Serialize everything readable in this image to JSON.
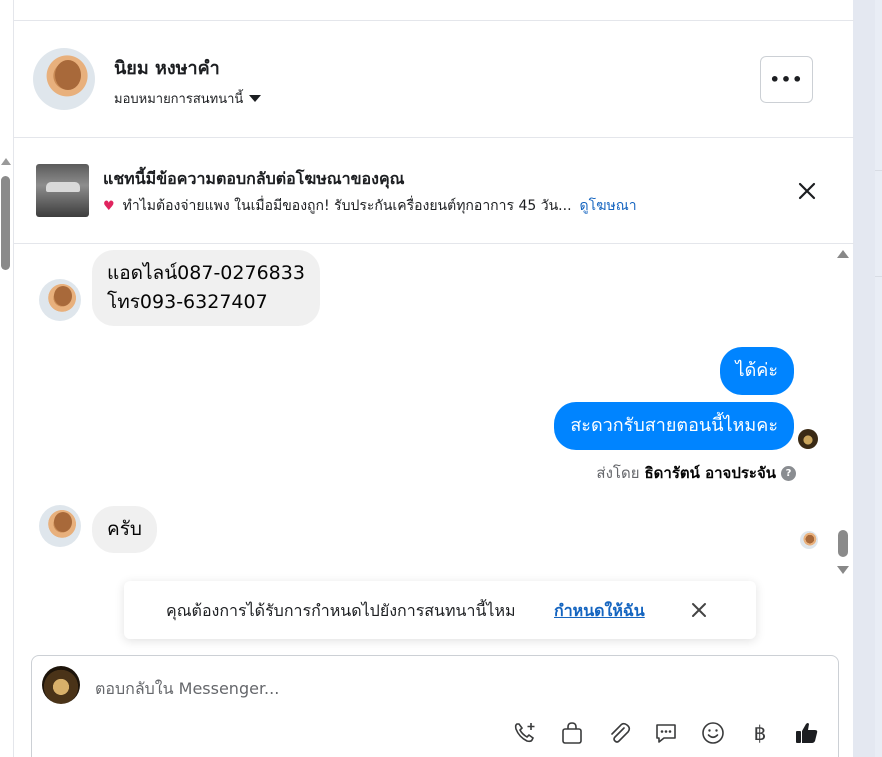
{
  "header": {
    "contact_name": "นิยม หงษาคำ",
    "assign_label": "มอบหมายการสนทนานี้",
    "more_label": "•••"
  },
  "ad": {
    "title": "แชทนี้มีข้อความตอบกลับต่อโฆษณาของคุณ",
    "subtitle": "ทำไมต้องจ่ายแพง ในเมื่อมีของถูก! รับประกันเครื่องยนต์ทุกอาการ 45 วัน...",
    "view_ad_link": "ดูโฆษณา"
  },
  "messages": {
    "incoming_1": "แอดไลน์087-0276833\nโทร093-6327407",
    "outgoing_1": "ได้ค่ะ",
    "outgoing_2": "สะดวกรับสายตอนนี้ไหมคะ",
    "sent_by_prefix": "ส่งโดย",
    "sent_by_name": "ธิดารัตน์ อาจประจัน",
    "incoming_2": "ครับ"
  },
  "toast": {
    "text": "คุณต้องการได้รับการกำหนดไปยังการสนทนานี้ไหม",
    "action": "กำหนดให้ฉัน"
  },
  "composer": {
    "placeholder": "ตอบกลับใน Messenger..."
  },
  "colors": {
    "outgoing_bubble": "#0084ff",
    "incoming_bubble": "#f0f0f0",
    "link": "#1565c0"
  }
}
